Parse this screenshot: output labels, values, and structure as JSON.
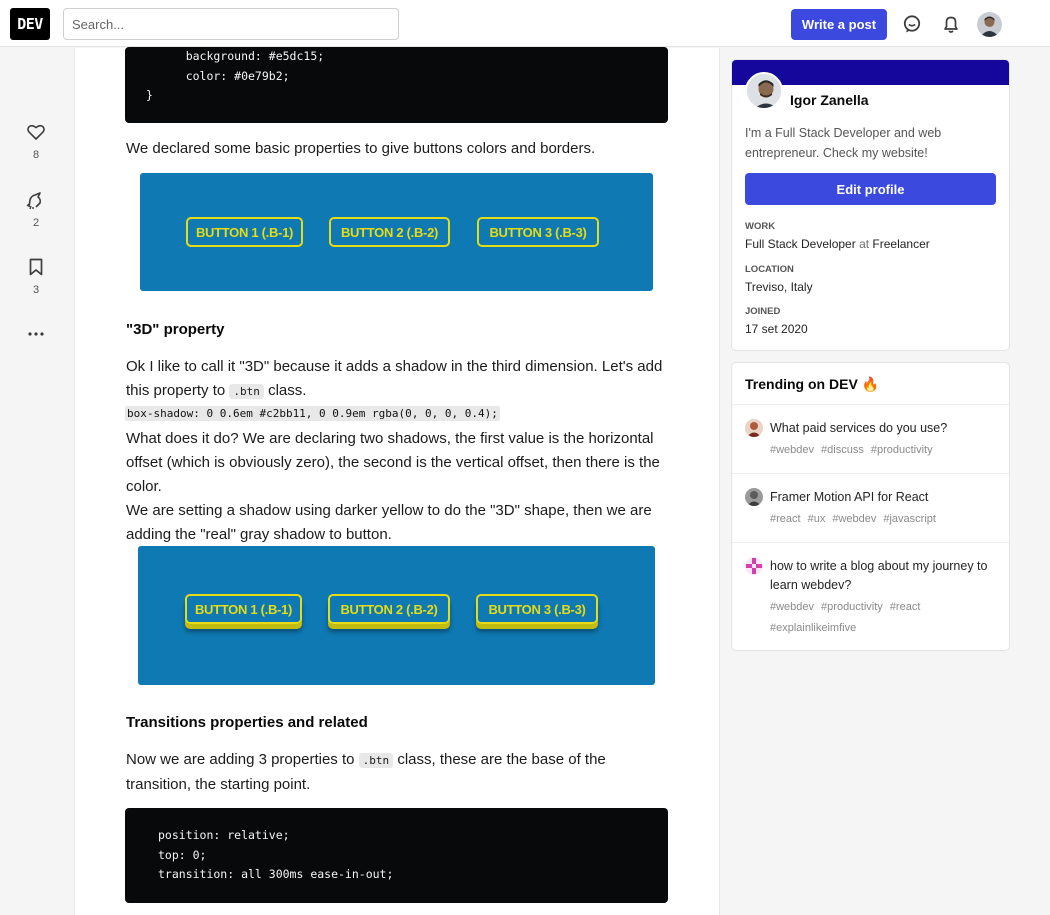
{
  "header": {
    "logo": "DEV",
    "search_placeholder": "Search...",
    "write_post": "Write a post"
  },
  "reactions": [
    {
      "icon": "heart-icon",
      "count": "8"
    },
    {
      "icon": "unicorn-icon",
      "count": "2"
    },
    {
      "icon": "bookmark-icon",
      "count": "3"
    }
  ],
  "article": {
    "code1": [
      "    background: #e5dc15;",
      "    color: #0e79b2;",
      "}"
    ],
    "p1": "We declared some basic properties to give buttons colors and borders.",
    "demo_buttons": [
      "BUTTON 1 (.B-1)",
      "BUTTON 2 (.B-2)",
      "BUTTON 3 (.B-3)"
    ],
    "h_3d": "\"3D\" property",
    "p2_a": "Ok I like to call it \"3D\" because it adds a shadow in the third dimension. Let's add this property to",
    "p2_code": ".btn",
    "p2_b": "class.",
    "code_inline": "box-shadow: 0 0.6em #c2bb11, 0 0.9em rgba(0, 0, 0, 0.4);",
    "p3": "What does it do? We are declaring two shadows, the first value is the horizontal offset (which is obviously zero), the second is the vertical offset, then there is the color.",
    "p4": "We are setting a shadow using darker yellow to do the \"3D\" shape, then we are adding the \"real\" gray shadow to button.",
    "h_trans": "Transitions properties and related",
    "p5_a": "Now we are adding 3 properties to",
    "p5_code": ".btn",
    "p5_b": "class, these are the base of the transition, the starting point.",
    "code2": [
      "position: relative;",
      "top: 0;",
      "transition: all 300ms ease-in-out;"
    ],
    "colors": {
      "demo_bg": "#0e79b2",
      "demo_yellow": "#e5dc15",
      "demo_shadow": "#c2bb11"
    }
  },
  "profile": {
    "name": "Igor Zanella",
    "bio": "I'm a Full Stack Developer and web entrepreneur. Check my website!",
    "edit": "Edit profile",
    "work_label": "WORK",
    "work_role": "Full Stack Developer",
    "work_at": "at",
    "work_company": "Freelancer",
    "location_label": "LOCATION",
    "location": "Treviso, Italy",
    "joined_label": "JOINED",
    "joined": "17 set 2020",
    "banner_color": "#15079c"
  },
  "trending": {
    "title": "Trending on DEV",
    "fire": "🔥",
    "items": [
      {
        "title": "What paid services do you use?",
        "tags": [
          "#webdev",
          "#discuss",
          "#productivity"
        ]
      },
      {
        "title": "Framer Motion API for React",
        "tags": [
          "#react",
          "#ux",
          "#webdev",
          "#javascript"
        ]
      },
      {
        "title": "how to write a blog about my journey to learn webdev?",
        "tags": [
          "#webdev",
          "#productivity",
          "#react",
          "#explainlikeimfive"
        ]
      }
    ]
  }
}
